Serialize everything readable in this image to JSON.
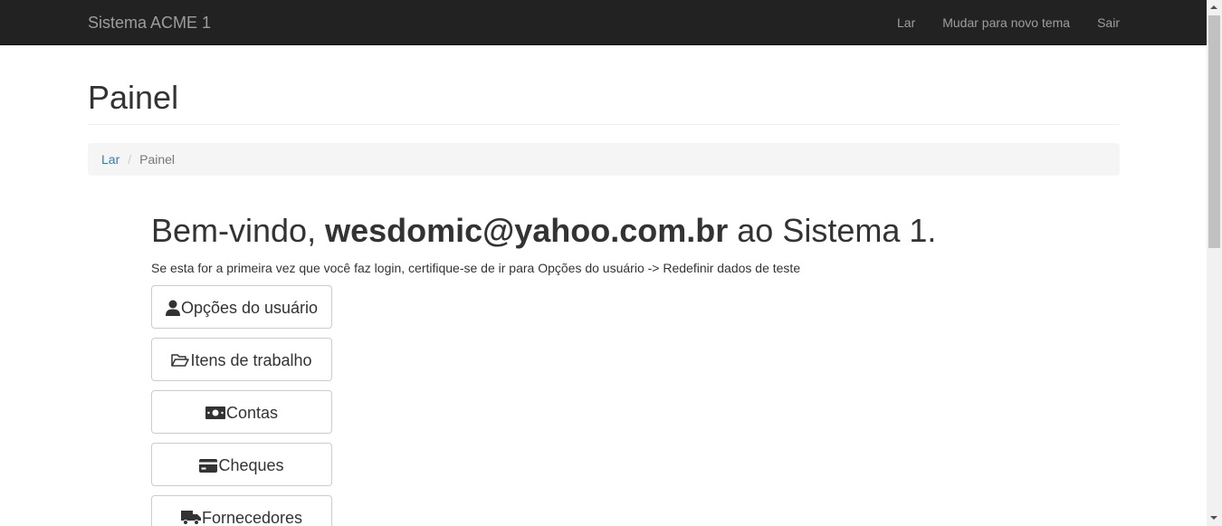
{
  "navbar": {
    "brand": "Sistema ACME 1",
    "links": [
      "Lar",
      "Mudar para novo tema",
      "Sair"
    ]
  },
  "page": {
    "title": "Painel"
  },
  "breadcrumb": {
    "home": "Lar",
    "separator": "/",
    "current": "Painel"
  },
  "welcome": {
    "prefix": "Bem-vindo, ",
    "user": "wesdomic@yahoo.com.br",
    "suffix": " ao Sistema 1.",
    "note": "Se esta for a primeira vez que você faz login, certifique-se de ir para Opções do usuário -> Redefinir dados de teste"
  },
  "menu": [
    {
      "label": "Opções do usuário",
      "icon": "user-icon"
    },
    {
      "label": "Itens de trabalho",
      "icon": "folder-open-icon"
    },
    {
      "label": "Contas",
      "icon": "money-icon"
    },
    {
      "label": "Cheques",
      "icon": "credit-card-icon"
    },
    {
      "label": "Fornecedores",
      "icon": "truck-icon"
    }
  ],
  "colors": {
    "navbar_bg": "#222222",
    "navbar_text": "#9d9d9d",
    "link": "#337ab7",
    "breadcrumb_bg": "#f5f5f5"
  }
}
